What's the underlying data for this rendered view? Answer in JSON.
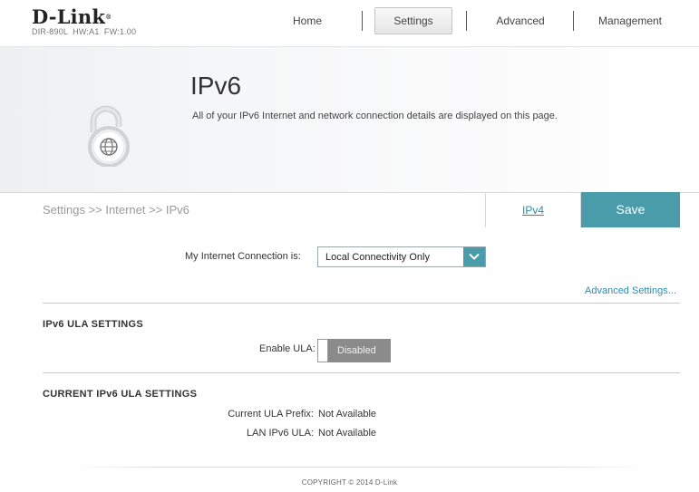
{
  "header": {
    "logo": "D-Link",
    "logo_mark": "®",
    "device_info": "DIR-890L  HW:A1  FW:1.00",
    "nav": {
      "home": "Home",
      "settings": "Settings",
      "advanced": "Advanced",
      "management": "Management"
    },
    "active_tab": "Settings"
  },
  "banner": {
    "title": "IPv6",
    "description": "All of your IPv6 Internet and network connection details are displayed on this page.",
    "icon": "unlocked-padlock-globe-icon"
  },
  "breadcrumb": "Settings >> Internet >> IPv6",
  "ipv4_link": "IPv4",
  "save_label": "Save",
  "connection": {
    "label": "My Internet Connection is:",
    "selected": "Local Connectivity Only"
  },
  "advanced_settings_link": "Advanced Settings...",
  "ula_settings": {
    "heading": "IPv6 ULA SETTINGS",
    "enable_label": "Enable ULA:",
    "toggle_state": "Disabled"
  },
  "current_ula": {
    "heading": "CURRENT IPv6 ULA SETTINGS",
    "rows": [
      {
        "label": "Current ULA Prefix:",
        "value": "Not Available"
      },
      {
        "label": "LAN IPv6 ULA:",
        "value": "Not Available"
      }
    ]
  },
  "footer": {
    "copyright": "COPYRIGHT © 2014 D-Link"
  },
  "colors": {
    "accent": "#4a9caa",
    "link": "#2a8db0",
    "toggle_off": "#8b8b8b"
  }
}
